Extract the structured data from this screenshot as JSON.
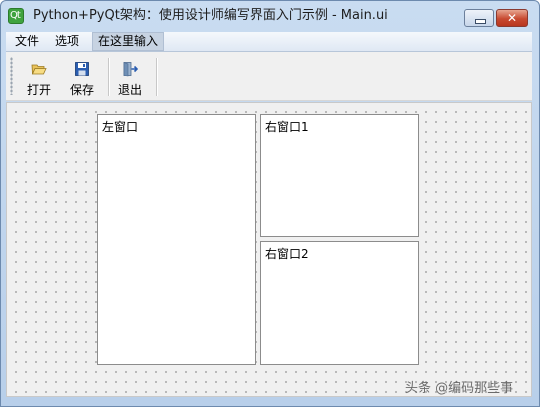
{
  "window": {
    "title": "Python+PyQt架构：使用设计师编写界面入门示例 - Main.ui",
    "app_icon_text": "Qt"
  },
  "menubar": {
    "items": [
      {
        "label": "文件"
      },
      {
        "label": "选项"
      },
      {
        "label": "在这里输入"
      }
    ]
  },
  "toolbar": {
    "items": [
      {
        "label": "打开",
        "icon": "folder-open-icon"
      },
      {
        "label": "保存",
        "icon": "floppy-save-icon"
      },
      {
        "label": "退出",
        "icon": "exit-door-icon"
      }
    ]
  },
  "panes": {
    "left": "左窗口",
    "right1": "右窗口1",
    "right2": "右窗口2"
  },
  "watermark": "头条 @编码那些事"
}
